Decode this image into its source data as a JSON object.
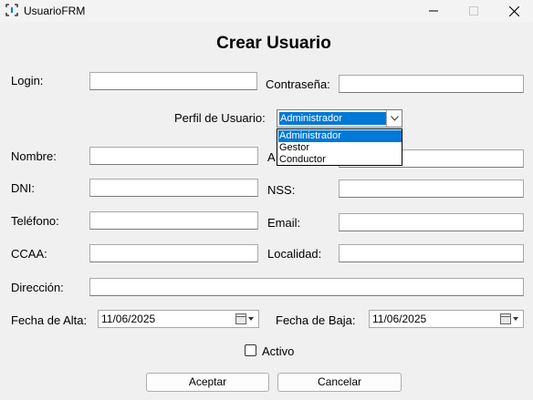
{
  "window": {
    "title": "UsuarioFRM"
  },
  "form": {
    "title": "Crear Usuario",
    "labels": {
      "login": "Login:",
      "password": "Contraseña:",
      "profile": "Perfil de Usuario:",
      "nombre": "Nombre:",
      "apellidos_partial": "A",
      "dni": "DNI:",
      "nss": "NSS:",
      "telefono": "Teléfono:",
      "email": "Email:",
      "ccaa": "CCAA:",
      "localidad": "Localidad:",
      "direccion": "Dirección:",
      "fecha_alta": "Fecha de Alta:",
      "fecha_baja": "Fecha de Baja:"
    },
    "fields": {
      "login": "",
      "password": "",
      "nombre": "",
      "apellidos": "",
      "dni": "",
      "nss": "",
      "telefono": "",
      "email": "",
      "ccaa": "",
      "localidad": "",
      "direccion": ""
    },
    "profile": {
      "selected": "Administrador",
      "options": [
        "Administrador",
        "Gestor",
        "Conductor"
      ]
    },
    "fecha_alta_value": "11/06/2025",
    "fecha_baja_value": "11/06/2025",
    "activo": {
      "label": "Activo",
      "checked": false
    },
    "buttons": {
      "accept": "Aceptar",
      "cancel": "Cancelar"
    }
  },
  "colors": {
    "selection": "#0078d7",
    "background": "#f0f0f0"
  }
}
